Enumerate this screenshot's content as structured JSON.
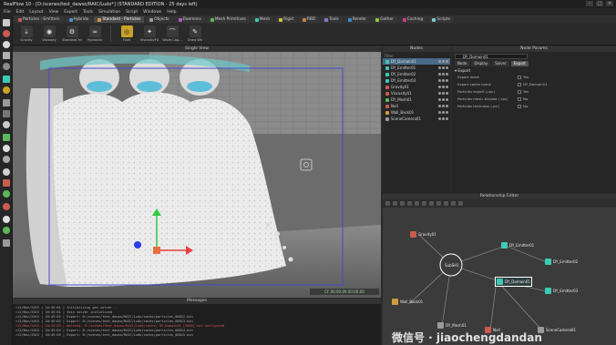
{
  "window": {
    "title": "RealFlow 10 - [D:/scenes/test_dawso/RAIC/Ludo*] (STANDARD EDITION - 25 days left)",
    "controls": [
      "–",
      "□",
      "✕"
    ]
  },
  "menu": [
    "File",
    "Edit",
    "Layout",
    "View",
    "Export",
    "Tools",
    "Simulation",
    "Script",
    "Windows",
    "Help"
  ],
  "shelf_tabs": [
    {
      "label": "Particles - Emitters",
      "color": "#c95b4f",
      "active": false
    },
    {
      "label": "Hybrido",
      "color": "#4f8ec9",
      "active": false
    },
    {
      "label": "Standard - Particles",
      "color": "#d09a3e",
      "active": true
    },
    {
      "label": "Objects",
      "color": "#9a9a9a",
      "active": false
    },
    {
      "label": "Daemons",
      "color": "#b05cc0",
      "active": false
    },
    {
      "label": "Mesh Primitives",
      "color": "#5cb85c",
      "active": false
    },
    {
      "label": "Mesh",
      "color": "#3ec9b5",
      "active": false
    },
    {
      "label": "Rigid",
      "color": "#c9c93e",
      "active": false
    },
    {
      "label": "RBD",
      "color": "#c97f3e",
      "active": false
    },
    {
      "label": "Tools",
      "color": "#7f7fc9",
      "active": false
    },
    {
      "label": "Render",
      "color": "#3e8ec9",
      "active": false
    },
    {
      "label": "Gather",
      "color": "#8ec93e",
      "active": false
    },
    {
      "label": "Caching",
      "color": "#c93e7f",
      "active": false
    },
    {
      "label": "Scripts",
      "color": "#7fc9c9",
      "active": false
    }
  ],
  "shelf_tools": [
    {
      "label": "Gravity",
      "glyph": "⇣",
      "highlight": false
    },
    {
      "label": "Viscosity",
      "glyph": "◉",
      "highlight": false
    },
    {
      "label": "Standard Ini",
      "glyph": "⚙",
      "highlight": false
    },
    {
      "label": "Hydraulic",
      "glyph": "≈",
      "highlight": false
    },
    {
      "label": "Fluid",
      "glyph": "◎",
      "highlight": true
    },
    {
      "label": "ViscosityFX",
      "glyph": "✦",
      "highlight": false
    },
    {
      "label": "Wave Cap...",
      "glyph": "⌒",
      "highlight": false
    },
    {
      "label": "Draw Wk",
      "glyph": "✎",
      "highlight": false
    }
  ],
  "viewport": {
    "title": "Single View",
    "footer": "CF 00:00:09  00:00:00",
    "bg": "#6c6c6c"
  },
  "messages": {
    "title": "Messages",
    "lines": [
      {
        "text": ">12/Nov/2015 | 10:45:01 | Initializing gas solver...",
        "err": false
      },
      {
        "text": ">12/Nov/2015 | 10:45:01 | Skin solver initialized",
        "err": false
      },
      {
        "text": ">12/Nov/2015 | 10:45:02 | Export: D:/scenes/test_dawso/RAIC/Ludo/cache/particles_00012.bin",
        "err": false
      },
      {
        "text": ">12/Nov/2015 | 10:45:02 | Export: D:/scenes/test_dawso/RAIC/Ludo/cache/particles_00013.bin",
        "err": false
      },
      {
        "text": ">12/Nov/2015 | 10:45:03 | Warning: D:/scenes/test_dawso/RAIC/Ludo/cache/ DY_Domain01 [S600] not configured",
        "err": true
      },
      {
        "text": ">12/Nov/2015 | 10:45:04 | Export: D:/scenes/test_dawso/RAIC/Ludo/cache/particles_00014.bin",
        "err": false
      },
      {
        "text": ">12/Nov/2015 | 10:45:05 | Export: D:/scenes/test_dawso/RAIC/Ludo/cache/particles_00015.bin",
        "err": false
      }
    ]
  },
  "nodes_panel": {
    "title": "Nodes",
    "filter": "Filter",
    "items": [
      {
        "label": "DY_Domain01",
        "color": "#3ec9b5",
        "selected": true
      },
      {
        "label": "DY_Emitter01",
        "color": "#3ec9b5",
        "selected": false
      },
      {
        "label": "DY_Emitter02",
        "color": "#3ec9b5",
        "selected": false
      },
      {
        "label": "DY_Emitter03",
        "color": "#3ec9b5",
        "selected": false
      },
      {
        "label": "Gravity01",
        "color": "#c95b4f",
        "selected": false
      },
      {
        "label": "Viscosity01",
        "color": "#c95b4f",
        "selected": false
      },
      {
        "label": "DY_Mesh01",
        "color": "#5cb85c",
        "selected": false
      },
      {
        "label": "Null",
        "color": "#c95b4f",
        "selected": false
      },
      {
        "label": "Wall_Back01",
        "color": "#d09a3e",
        "selected": false
      },
      {
        "label": "SceneCamera01",
        "color": "#9a9a9a",
        "selected": false
      }
    ]
  },
  "node_params": {
    "title": "Node Params",
    "name": "DY_Domain01",
    "tabs": [
      {
        "label": "Node",
        "active": false
      },
      {
        "label": "Display",
        "active": false
      },
      {
        "label": "Solver",
        "active": false
      },
      {
        "label": "Export",
        "active": true
      }
    ],
    "section": "▾ Export",
    "rows": [
      {
        "label": "Export mesh",
        "value": "Yes"
      },
      {
        "label": "Export cache name",
        "value": "DY_Domain01"
      },
      {
        "label": "Particles export (.rpc)",
        "value": "Yes"
      },
      {
        "label": "Particles mesh .bin/abc (.rpc)",
        "value": "No"
      },
      {
        "label": "Particles thickness (.pci)",
        "value": "No"
      }
    ]
  },
  "relationship": {
    "title": "Relationship Editor",
    "hub_label": "SubSH1",
    "nodes": [
      {
        "label": "Gravity01",
        "color": "#c95b4f",
        "selected": false
      },
      {
        "label": "DY_Emitter01",
        "color": "#3ec9b5",
        "selected": false
      },
      {
        "label": "DY_Emitter02",
        "color": "#3ec9b5",
        "selected": false
      },
      {
        "label": "DY_Domain01",
        "color": "#3ec9b5",
        "selected": true
      },
      {
        "label": "DY_Emitter03",
        "color": "#3ec9b5",
        "selected": false
      },
      {
        "label": "Wall_Back01",
        "color": "#d09a3e",
        "selected": false
      },
      {
        "label": "DY_Mesh01",
        "color": "#9a9a9a",
        "selected": false
      },
      {
        "label": "Null",
        "color": "#c95b4f",
        "selected": false
      },
      {
        "label": "SceneCamera01",
        "color": "#9a9a9a",
        "selected": false
      }
    ]
  },
  "watermark": "微信号 · jiaochengdandan"
}
